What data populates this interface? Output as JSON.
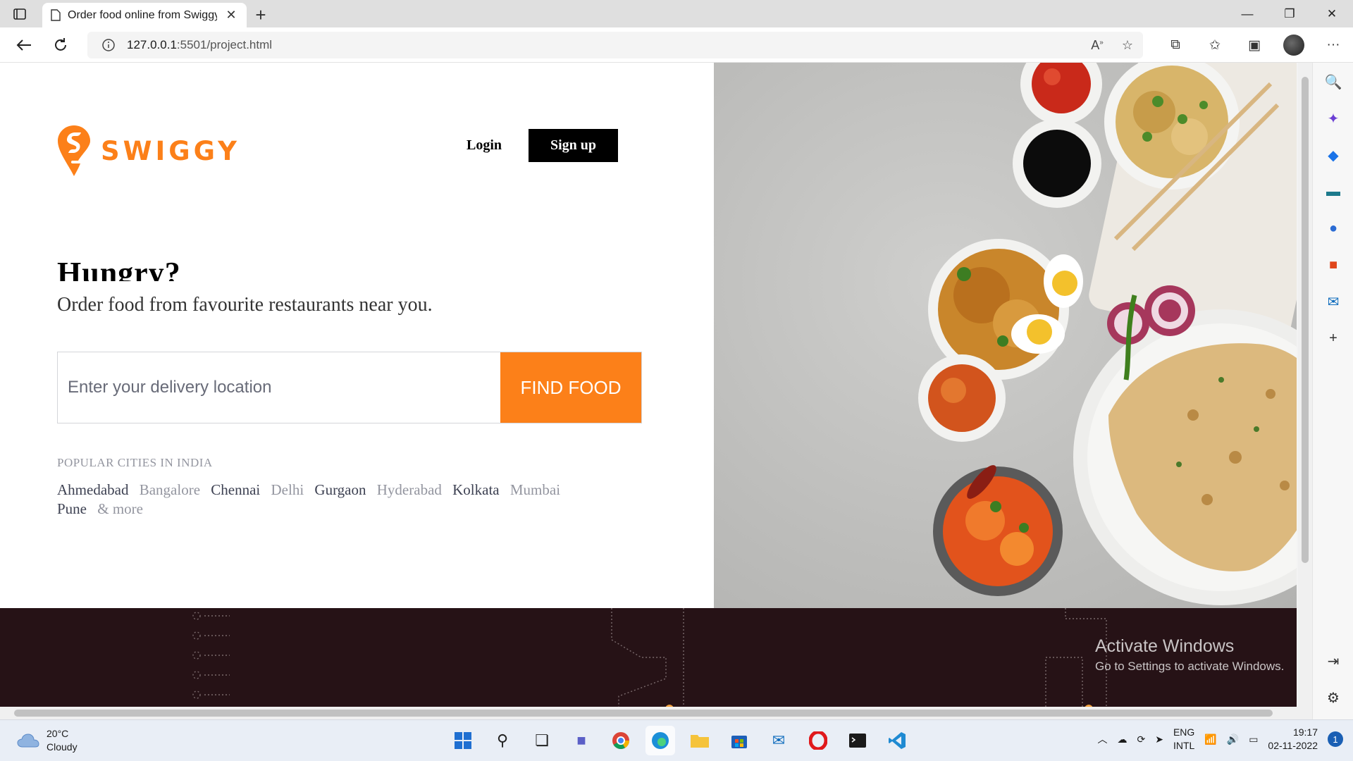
{
  "browser": {
    "tab_title": "Order food online from Swiggy",
    "url_host": "127.0.0.1",
    "url_rest": ":5501/project.html"
  },
  "site": {
    "logo_text": "SWIGGY",
    "login_label": "Login",
    "signup_label": "Sign up",
    "headline": "Hungry?",
    "subheadline": "Order food from favourite restaurants near you.",
    "search_placeholder": "Enter your delivery location",
    "find_food_label": "FIND FOOD",
    "cities_title": "POPULAR CITIES IN INDIA",
    "cities": [
      "Ahmedabad",
      "Bangalore",
      "Chennai",
      "Delhi",
      "Gurgaon",
      "Hyderabad",
      "Kolkata",
      "Mumbai",
      "Pune",
      "& more"
    ],
    "brand_color": "#fc8019"
  },
  "watermark": {
    "line1": "Activate Windows",
    "line2": "Go to Settings to activate Windows."
  },
  "taskbar": {
    "temperature": "20°C",
    "weather": "Cloudy",
    "lang1": "ENG",
    "lang2": "INTL",
    "time": "19:17",
    "date": "02-11-2022",
    "notification_count": "1"
  }
}
